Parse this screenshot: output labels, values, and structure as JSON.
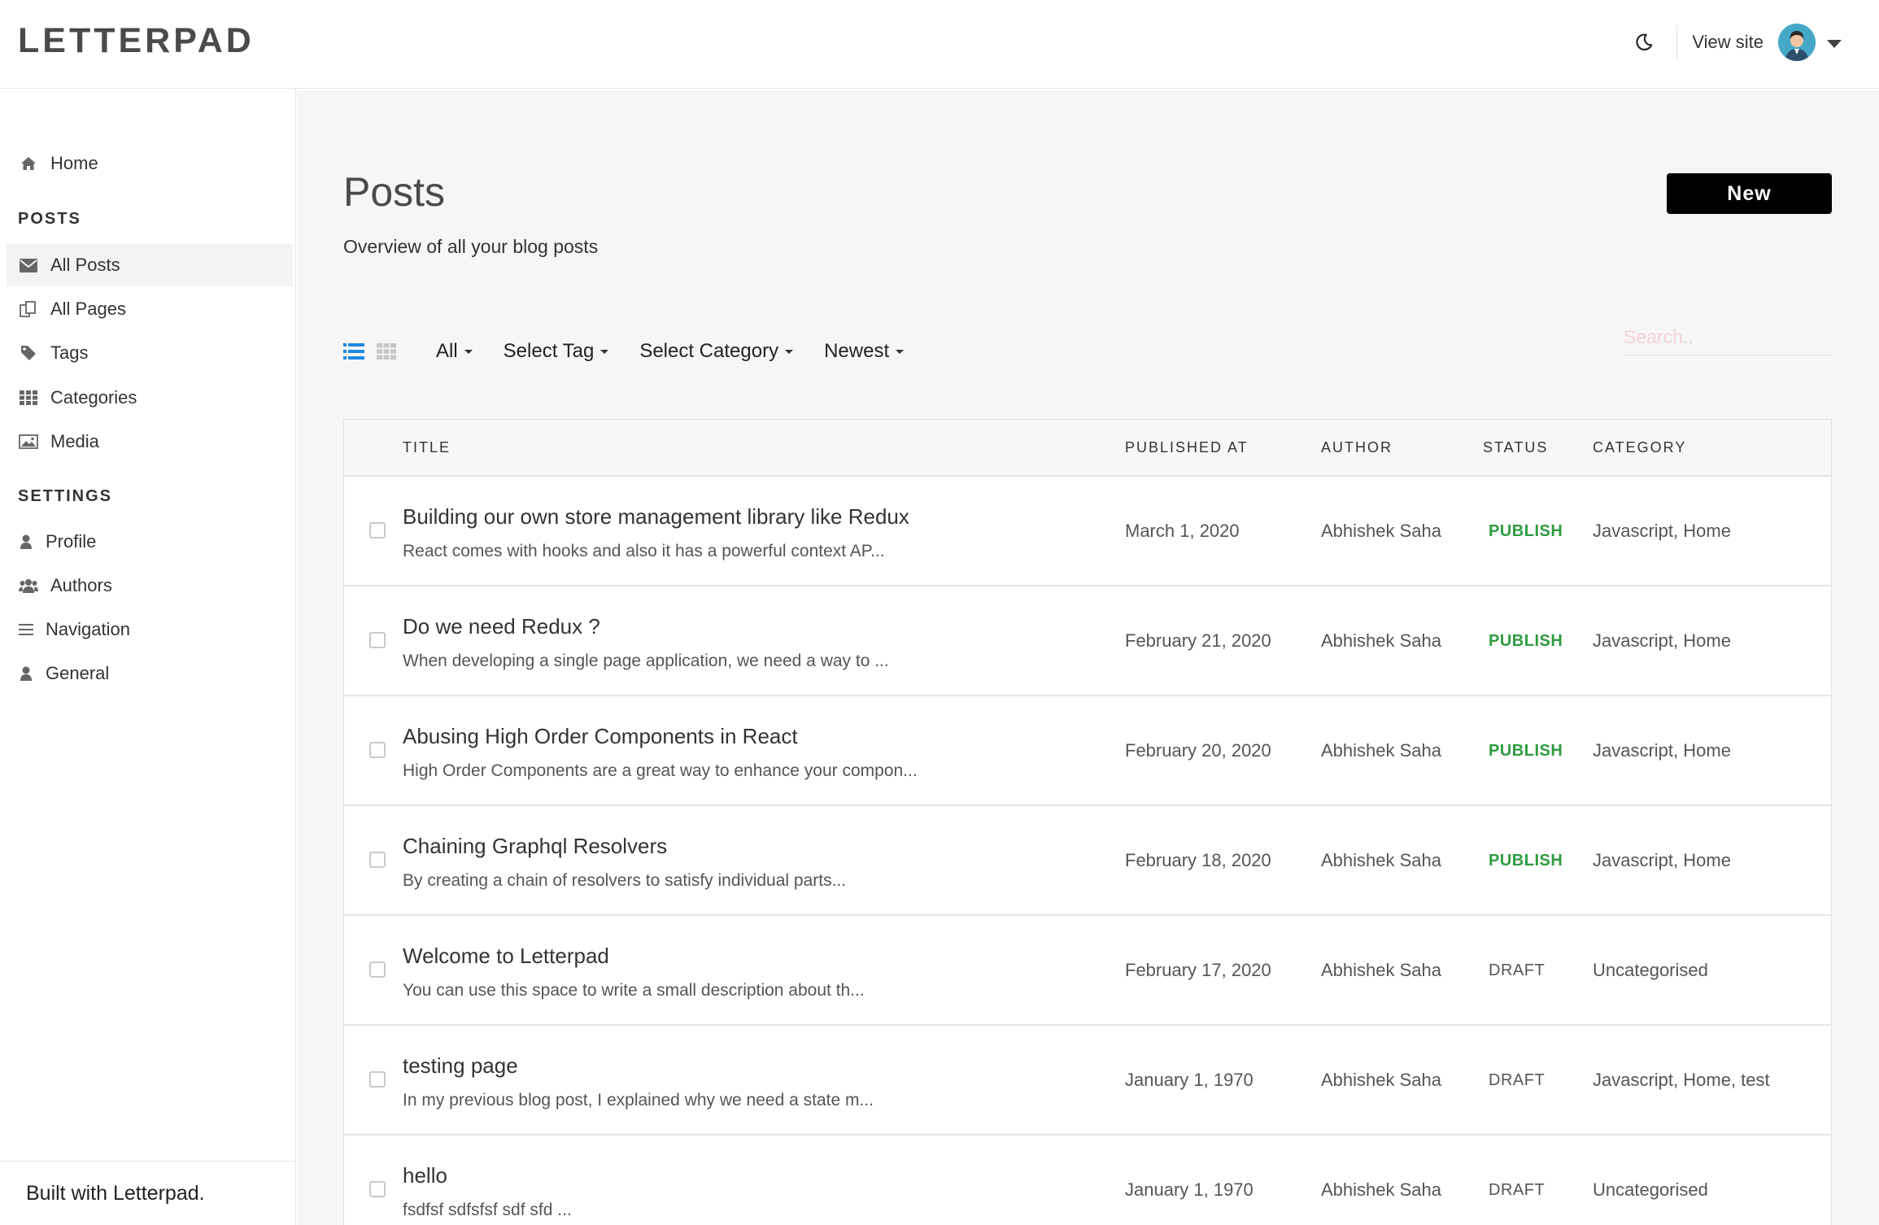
{
  "app": {
    "logo": "LETTERPAD",
    "view_site": "View site"
  },
  "sidebar": {
    "home": "Home",
    "posts_heading": "POSTS",
    "posts_items": [
      "All Posts",
      "All Pages",
      "Tags",
      "Categories",
      "Media"
    ],
    "settings_heading": "SETTINGS",
    "settings_items": [
      "Profile",
      "Authors",
      "Navigation",
      "General"
    ],
    "footer": "Built with Letterpad."
  },
  "page": {
    "title": "Posts",
    "subtitle": "Overview of all your blog posts",
    "new_button": "New",
    "search_placeholder": "Search.."
  },
  "filters": [
    "All",
    "Select Tag",
    "Select Category",
    "Newest"
  ],
  "table": {
    "columns": [
      "TITLE",
      "PUBLISHED AT",
      "AUTHOR",
      "STATUS",
      "CATEGORY"
    ],
    "rows": [
      {
        "title": "Building our own store management library like Redux",
        "excerpt": "React comes with hooks and also it has a powerful context AP...",
        "published": "March 1, 2020",
        "author": "Abhishek Saha",
        "status": "PUBLISH",
        "category": "Javascript, Home"
      },
      {
        "title": "Do we need Redux ?",
        "excerpt": "When developing a single page application, we need a way to ...",
        "published": "February 21, 2020",
        "author": "Abhishek Saha",
        "status": "PUBLISH",
        "category": "Javascript, Home"
      },
      {
        "title": "Abusing High Order Components in React",
        "excerpt": "High Order Components are a great way to enhance your compon...",
        "published": "February 20, 2020",
        "author": "Abhishek Saha",
        "status": "PUBLISH",
        "category": "Javascript, Home"
      },
      {
        "title": "Chaining Graphql Resolvers",
        "excerpt": "By creating a chain of resolvers to satisfy individual parts...",
        "published": "February 18, 2020",
        "author": "Abhishek Saha",
        "status": "PUBLISH",
        "category": "Javascript, Home"
      },
      {
        "title": "Welcome to Letterpad",
        "excerpt": "You can use this space to write a small description about th...",
        "published": "February 17, 2020",
        "author": "Abhishek Saha",
        "status": "DRAFT",
        "category": "Uncategorised"
      },
      {
        "title": "testing page",
        "excerpt": "In my previous blog post, I explained why we need a state m...",
        "published": "January 1, 1970",
        "author": "Abhishek Saha",
        "status": "DRAFT",
        "category": "Javascript, Home, test"
      },
      {
        "title": "hello",
        "excerpt": "fsdfsf sdfsfsf sdf sfd ...",
        "published": "January 1, 1970",
        "author": "Abhishek Saha",
        "status": "DRAFT",
        "category": "Uncategorised"
      }
    ]
  },
  "colors": {
    "publish": "#2e9b3f",
    "accent": "#1e88e5",
    "button": "#000000"
  }
}
